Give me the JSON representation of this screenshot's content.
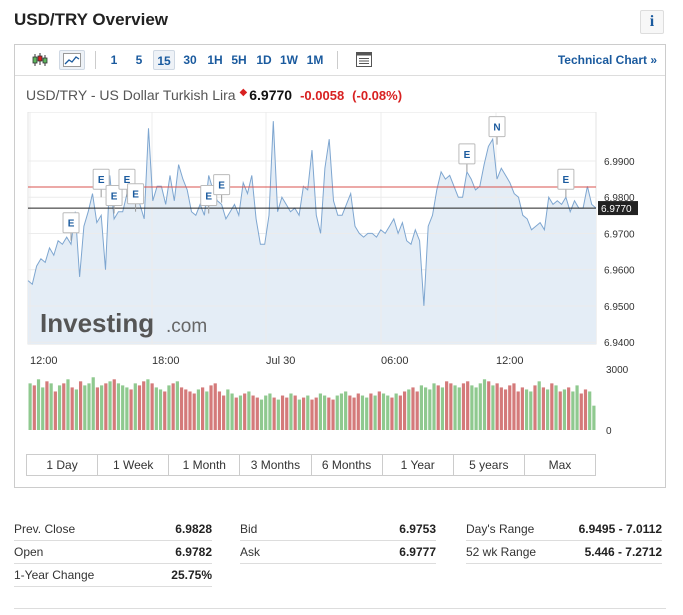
{
  "header": {
    "title": "USD/TRY Overview"
  },
  "toolbar": {
    "timeframes": [
      "1",
      "5",
      "15",
      "30",
      "1H",
      "5H",
      "1D",
      "1W",
      "1M"
    ],
    "active_timeframe": "15",
    "technical_chart_label": "Technical Chart »"
  },
  "quote": {
    "pair_name": "USD/TRY - US Dollar Turkish Lira",
    "price": "6.9770",
    "change": "-0.0058",
    "change_pct": "(-0.08%)"
  },
  "colors": {
    "accent": "#1a5a9e",
    "negative": "#d82121",
    "positive": "#5cb85c",
    "line": "#7ea6d0",
    "area": "#e4edf6"
  },
  "chart_data": {
    "type": "area",
    "x_ticks": [
      "12:00",
      "18:00",
      "Jul 30",
      "06:00",
      "12:00"
    ],
    "y_ticks": [
      "6.9900",
      "6.9800",
      "6.9700",
      "6.9600",
      "6.9500",
      "6.9400"
    ],
    "ylim": [
      6.9395,
      7.0035
    ],
    "last_price_label": "6.9770",
    "last_price": 6.977,
    "prev_close": 6.9828,
    "prices": [
      6.957,
      6.956,
      6.961,
      6.963,
      6.962,
      6.966,
      6.964,
      6.968,
      6.967,
      6.969,
      6.967,
      6.976,
      6.958,
      6.972,
      6.976,
      6.981,
      6.973,
      6.975,
      6.96,
      6.986,
      6.974,
      6.976,
      6.976,
      6.981,
      6.98,
      6.982,
      6.978,
      6.974,
      6.999,
      6.979,
      6.983,
      6.983,
      6.978,
      6.986,
      6.979,
      6.989,
      6.985,
      6.982,
      6.976,
      6.975,
      6.978,
      6.975,
      6.986,
      6.982,
      6.979,
      6.978,
      6.974,
      6.976,
      6.978,
      6.975,
      6.984,
      6.981,
      6.986,
      6.974,
      6.967,
      6.967,
      6.975,
      7.001,
      6.976,
      6.98,
      6.978,
      6.976,
      6.977,
      6.975,
      6.983,
      6.982,
      6.993,
      6.975,
      6.97,
      6.988,
      6.996,
      6.979,
      6.975,
      6.975,
      6.978,
      6.981,
      6.972,
      6.97,
      6.969,
      6.97,
      6.97,
      6.969,
      6.971,
      6.97,
      6.972,
      6.974,
      6.97,
      6.973,
      6.968,
      6.967,
      6.971,
      6.968,
      6.95,
      6.972,
      6.975,
      6.982,
      6.987,
      6.985,
      6.986,
      6.983,
      6.98,
      6.98,
      6.987,
      6.985,
      6.982,
      6.983,
      6.989,
      6.994,
      6.996,
      6.985,
      6.988,
      6.986,
      6.984,
      6.981,
      6.98,
      6.975,
      6.974,
      6.971,
      6.972,
      6.973,
      6.971,
      6.98,
      6.978,
      6.979,
      6.978,
      6.98,
      6.976,
      6.979,
      6.977,
      6.977,
      6.983,
      6.978,
      6.977
    ],
    "events": [
      {
        "label": "E",
        "x_index": 10,
        "price": 6.968
      },
      {
        "label": "E",
        "x_index": 17,
        "price": 6.98
      },
      {
        "label": "E",
        "x_index": 20,
        "price": 6.9755
      },
      {
        "label": "E",
        "x_index": 23,
        "price": 6.98
      },
      {
        "label": "E",
        "x_index": 25,
        "price": 6.976
      },
      {
        "label": "E",
        "x_index": 42,
        "price": 6.9755
      },
      {
        "label": "E",
        "x_index": 45,
        "price": 6.9785
      },
      {
        "label": "E",
        "x_index": 102,
        "price": 6.987
      },
      {
        "label": "N",
        "x_index": 109,
        "price": 6.9945
      },
      {
        "label": "E",
        "x_index": 125,
        "price": 6.98
      }
    ],
    "volume_ticks": [
      "3000",
      "0"
    ],
    "volume_max": 3600,
    "volume": [
      2300,
      2200,
      2500,
      2100,
      2400,
      2300,
      1900,
      2200,
      2300,
      2500,
      2100,
      2000,
      2400,
      2200,
      2300,
      2600,
      2100,
      2200,
      2300,
      2400,
      2500,
      2300,
      2200,
      2100,
      2000,
      2300,
      2200,
      2400,
      2500,
      2300,
      2100,
      2000,
      1900,
      2200,
      2300,
      2400,
      2100,
      2000,
      1900,
      1800,
      2000,
      2100,
      1900,
      2200,
      2300,
      1900,
      1700,
      2000,
      1800,
      1600,
      1700,
      1800,
      1900,
      1700,
      1600,
      1500,
      1700,
      1800,
      1600,
      1500,
      1700,
      1600,
      1800,
      1700,
      1500,
      1600,
      1700,
      1500,
      1600,
      1800,
      1700,
      1600,
      1500,
      1700,
      1800,
      1900,
      1700,
      1600,
      1800,
      1700,
      1600,
      1800,
      1700,
      1900,
      1800,
      1700,
      1600,
      1800,
      1700,
      1900,
      2000,
      2100,
      1900,
      2200,
      2100,
      2000,
      2300,
      2200,
      2100,
      2400,
      2300,
      2200,
      2100,
      2300,
      2400,
      2200,
      2100,
      2300,
      2500,
      2400,
      2200,
      2300,
      2100,
      2000,
      2200,
      2300,
      1900,
      2100,
      2000,
      1900,
      2200,
      2400,
      2100,
      2000,
      2300,
      2200,
      1900,
      2000,
      2100,
      1900,
      2200,
      1800,
      2000,
      1900,
      1200
    ]
  },
  "branding": {
    "logo_text": "Investing",
    "logo_suffix": ".com"
  },
  "ranges": [
    "1 Day",
    "1 Week",
    "1 Month",
    "3 Months",
    "6 Months",
    "1 Year",
    "5 years",
    "Max"
  ],
  "stats": {
    "col1": [
      {
        "label": "Prev. Close",
        "value": "6.9828"
      },
      {
        "label": "Open",
        "value": "6.9782"
      },
      {
        "label": "1-Year Change",
        "value": "25.75%"
      }
    ],
    "col2": [
      {
        "label": "Bid",
        "value": "6.9753"
      },
      {
        "label": "Ask",
        "value": "6.9777"
      }
    ],
    "col3": [
      {
        "label": "Day's Range",
        "value": "6.9495 - 7.0112"
      },
      {
        "label": "52 wk Range",
        "value": "5.446 - 7.2712"
      }
    ]
  }
}
